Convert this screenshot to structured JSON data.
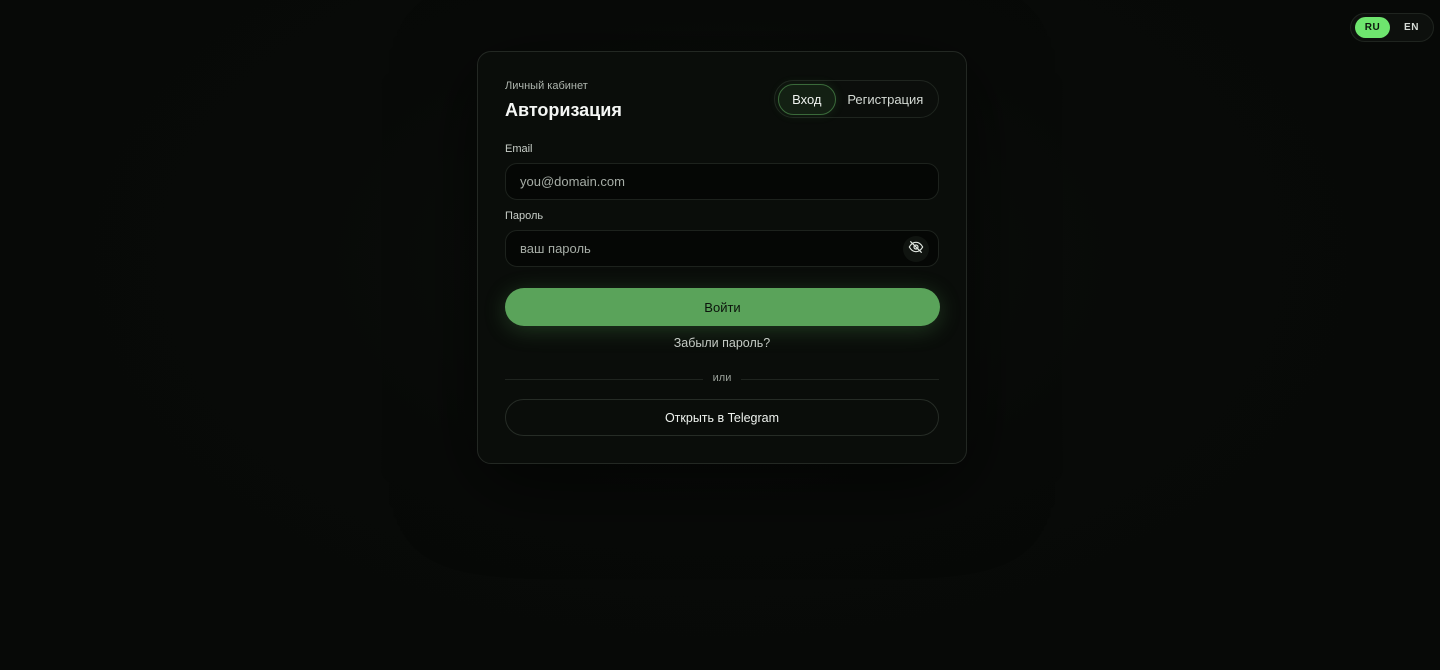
{
  "language_switch": {
    "options": [
      "RU",
      "EN"
    ],
    "active": "RU",
    "accent_color": "#6ee56e"
  },
  "auth_card": {
    "subtitle": "Личный кабинет",
    "title": "Авторизация",
    "tabs": [
      {
        "label": "Вход",
        "active": true
      },
      {
        "label": "Регистрация",
        "active": false
      }
    ],
    "email": {
      "label": "Email",
      "placeholder": "you@domain.com",
      "value": ""
    },
    "password": {
      "label": "Пароль",
      "placeholder": "ваш пароль",
      "value": "",
      "toggle_icon": "eye-off-icon"
    },
    "login_button": "Войти",
    "forgot_link": "Забыли пароль?",
    "divider_text": "или",
    "telegram_button": "Открыть в Telegram"
  },
  "colors": {
    "background": "#070907",
    "primary_button": "#5aa35a",
    "active_tab_border": "#3a6a3a"
  }
}
